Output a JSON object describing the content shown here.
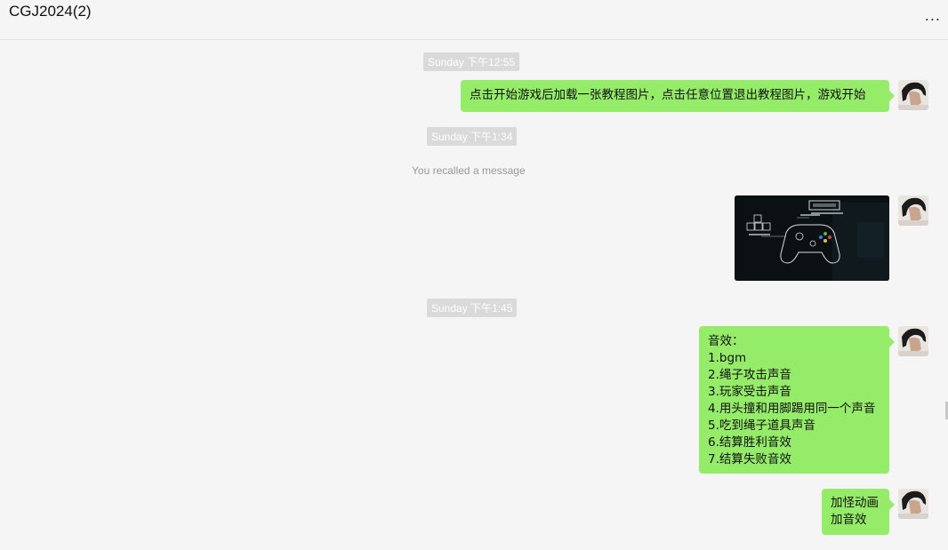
{
  "chat": {
    "title": "CGJ2024(2)",
    "more_label": "..."
  },
  "messages": {
    "time1": "Sunday 下午12:55",
    "msg1": "点击开始游戏后加载一张教程图片，点击任意位置退出教程图片，游戏开始",
    "time2": "Sunday 下午1:34",
    "recalled": "You recalled a message",
    "time3": "Sunday 下午1:45",
    "msg3_lines": [
      "音效：",
      "1.bgm",
      "2.绳子攻击声音",
      "3.玩家受击声音",
      "4.用头撞和用脚踢用同一个声音",
      "5.吃到绳子道具声音",
      "6.结算胜利音效",
      "7.结算失败音效"
    ],
    "msg4_lines": [
      "加怪动画",
      "加音效"
    ]
  },
  "colors": {
    "bubble": "#95ec69",
    "background": "#f5f5f5",
    "timestamp_bg": "#dadada"
  }
}
